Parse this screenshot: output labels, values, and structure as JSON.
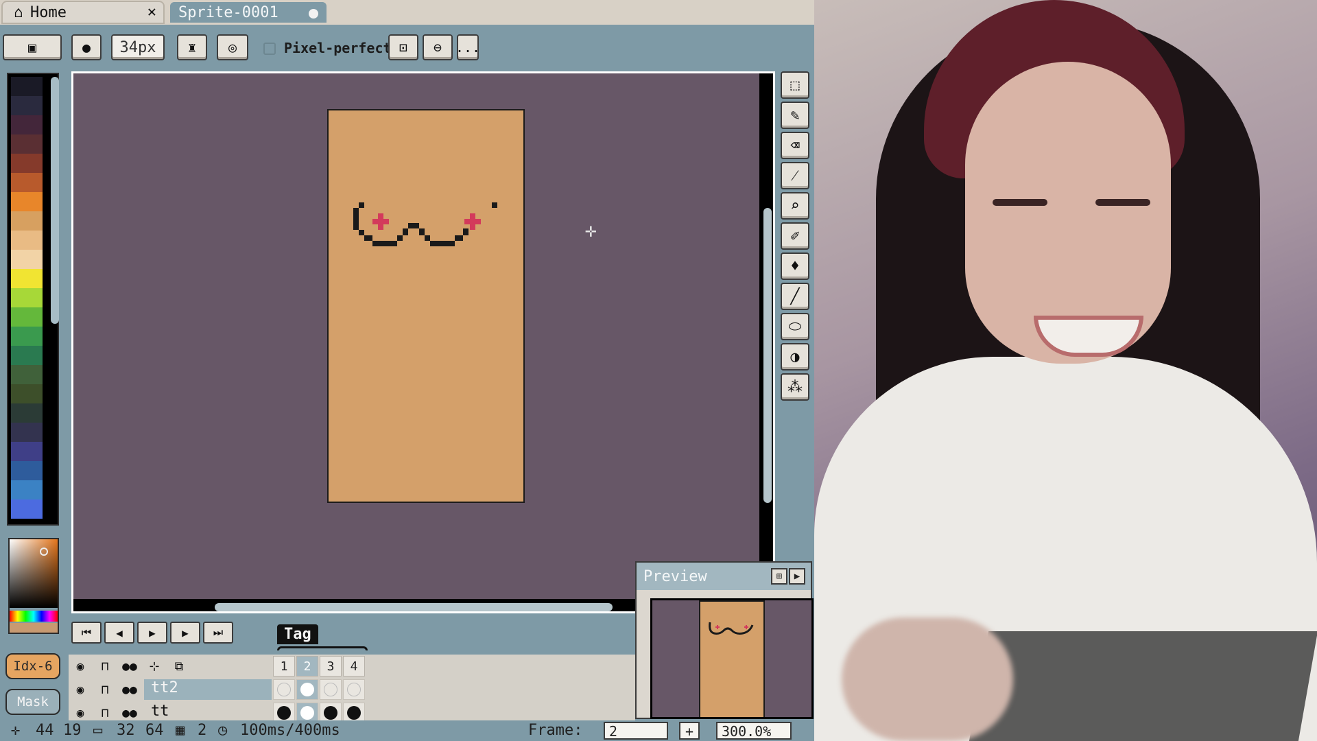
{
  "tabs": {
    "home_label": "Home",
    "sprite_label": "Sprite-0001"
  },
  "toolbar": {
    "brush_size": "34px",
    "pixel_perfect_label": "Pixel-perfect",
    "more_label": "..."
  },
  "palette": {
    "colors": [
      "#1a1a26",
      "#2a2a3e",
      "#43263a",
      "#5a2f33",
      "#853a2b",
      "#b85a2c",
      "#e8862a",
      "#d7a060",
      "#e9bb84",
      "#f2d3a6",
      "#f1e432",
      "#a7d838",
      "#64b83b",
      "#3a9a4e",
      "#2a7a50",
      "#40613a",
      "#3d4f2a",
      "#2b3b36",
      "#33334f",
      "#3f3f87",
      "#2e5c9c",
      "#3b82c4",
      "#4c6be0"
    ]
  },
  "left_buttons": {
    "index_label": "Idx-6",
    "mask_label": "Mask"
  },
  "preview": {
    "title": "Preview"
  },
  "timeline": {
    "tag_label": "Tag",
    "frames": [
      "1",
      "2",
      "3",
      "4"
    ],
    "layers": [
      {
        "name": "tt2"
      },
      {
        "name": "tt"
      }
    ]
  },
  "status": {
    "cursor_x": "44",
    "cursor_y": "19",
    "sprite_w": "32",
    "sprite_h": "64",
    "frame_count": "2",
    "duration": "100ms/400ms",
    "frame_label": "Frame:",
    "frame_value": "2",
    "zoom_value": "300.0%"
  },
  "colors": {
    "canvas_bg": "#675767",
    "sprite_fill": "#d4a06a",
    "ui_accent": "#7e9aa6",
    "index_button": "#e6a561"
  }
}
